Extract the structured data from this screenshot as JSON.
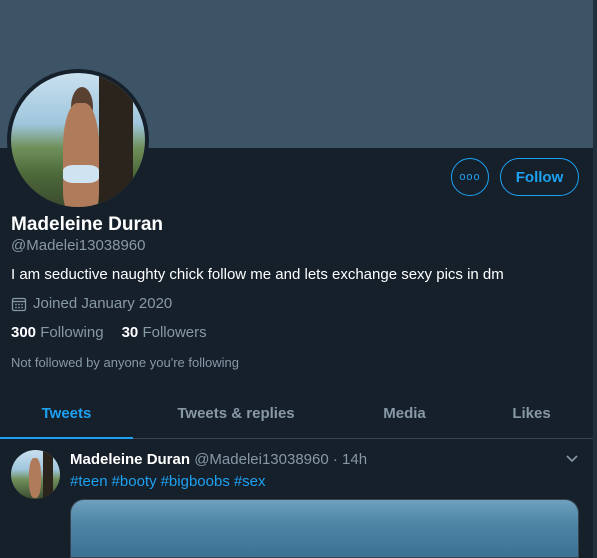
{
  "profile": {
    "name": "Madeleine Duran",
    "handle": "@Madelei13038960",
    "bio": "I am seductive naughty chick follow me and lets exchange sexy pics in dm",
    "joined": "Joined January 2020",
    "following_count": "300",
    "following_label": "Following",
    "followers_count": "30",
    "followers_label": "Followers",
    "not_followed": "Not followed by anyone you're following"
  },
  "actions": {
    "more_label": "ooo",
    "follow_label": "Follow"
  },
  "tabs": [
    {
      "label": "Tweets",
      "active": true
    },
    {
      "label": "Tweets & replies",
      "active": false
    },
    {
      "label": "Media",
      "active": false
    },
    {
      "label": "Likes",
      "active": false
    }
  ],
  "tweet": {
    "author_name": "Madeleine Duran",
    "author_handle": "@Madelei13038960",
    "separator": "·",
    "time": "14h",
    "hashtags": [
      "#teen",
      "#booty",
      "#bigboobs",
      "#sex"
    ]
  },
  "colors": {
    "background": "#15202b",
    "banner": "#3d5466",
    "accent": "#1da1f2",
    "secondary_text": "#8899a6"
  }
}
